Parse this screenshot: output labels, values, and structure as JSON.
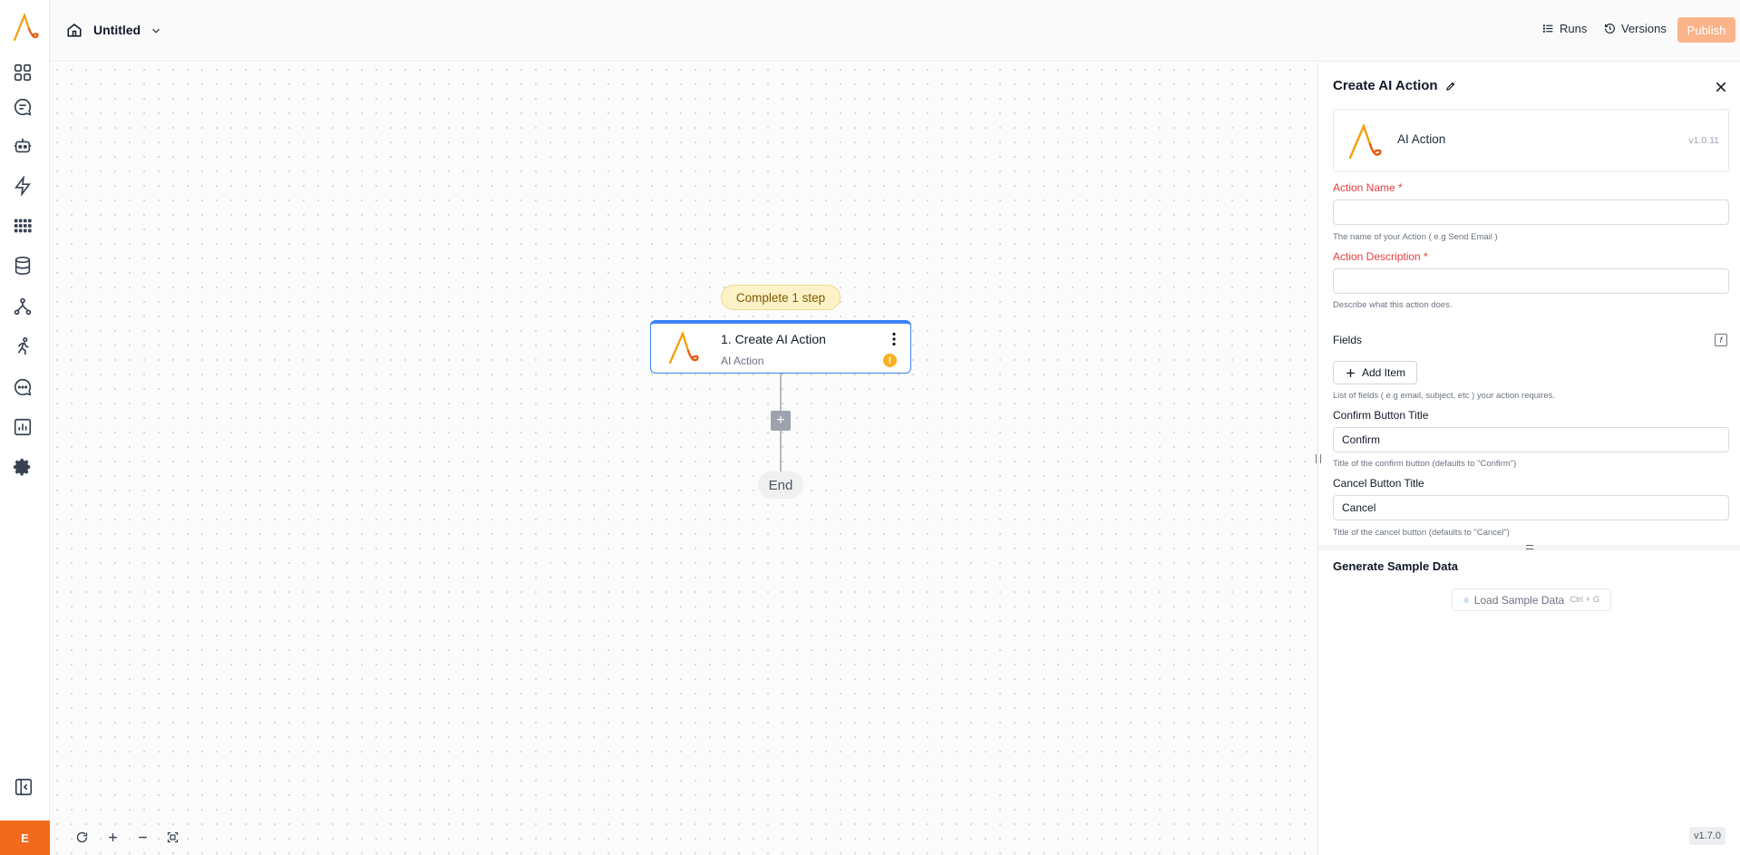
{
  "header": {
    "title": "Untitled",
    "runs_label": "Runs",
    "versions_label": "Versions",
    "publish_label": "Publish"
  },
  "rail": {
    "avatar_initial": "E",
    "items": [
      "dashboard-icon",
      "chat-icon",
      "bot-icon",
      "flash-icon",
      "apps-grid-icon",
      "database-icon",
      "flow-icon",
      "running-icon",
      "messages-icon",
      "analytics-icon",
      "settings-icon"
    ]
  },
  "canvas": {
    "complete_badge": "Complete 1 step",
    "step": {
      "title": "1. Create AI Action",
      "subtitle": "AI Action",
      "warning": "!"
    },
    "end_label": "End",
    "add_label": "+"
  },
  "panel": {
    "title": "Create AI Action",
    "piece_name": "AI Action",
    "piece_version": "v1.0.11",
    "action_name": {
      "label": "Action Name *",
      "value": "",
      "help": "The name of your Action ( e.g Send Email )"
    },
    "action_description": {
      "label": "Action Description *",
      "value": "",
      "help": "Describe what this action does."
    },
    "fields": {
      "label": "Fields",
      "fx": "f",
      "add_item_label": "Add Item",
      "help": "List of fields ( e.g email, subject, etc ) your action requires."
    },
    "confirm_title": {
      "label": "Confirm Button Title",
      "value": "Confirm",
      "help": "Title of the confirm button (defaults to \"Confirm\")"
    },
    "cancel_title": {
      "label": "Cancel Button Title",
      "value": "Cancel",
      "help": "Title of the cancel button (defaults to \"Cancel\")"
    },
    "sample_data": {
      "title": "Generate Sample Data",
      "load_label": "Load Sample Data",
      "shortcut": "Ctrl + G"
    }
  },
  "app_version": "v1.7.0",
  "colors": {
    "accent_blue": "#3b82f6",
    "brand_orange": "#f26b1d",
    "publish_disabled": "#fbb48a",
    "required_red": "#e53e3e"
  }
}
